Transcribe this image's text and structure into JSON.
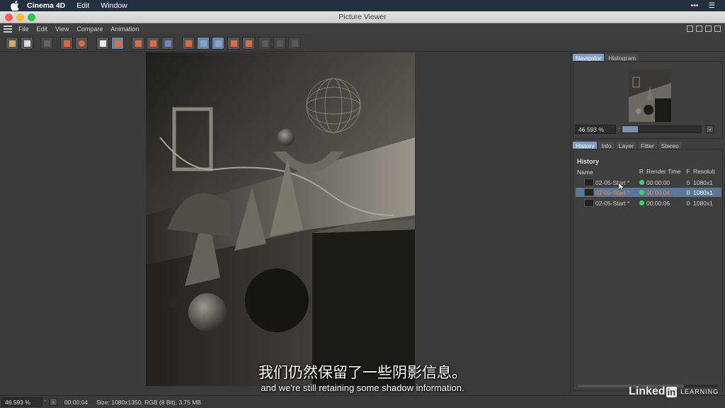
{
  "menubar": {
    "app_name": "Cinema 4D",
    "items": [
      "Edit",
      "Window"
    ]
  },
  "window": {
    "title": "Picture Viewer",
    "colors": {
      "close": "#fe5f57",
      "minimize": "#febc2e",
      "zoom": "#28c840"
    }
  },
  "app_menu": [
    "File",
    "Edit",
    "View",
    "Compare",
    "Animation"
  ],
  "navigator": {
    "tabs": [
      "Navigator",
      "Histogram"
    ],
    "zoom_value": "46.593 %"
  },
  "history_panel": {
    "tabs": [
      "History",
      "Info",
      "Layer",
      "Filter",
      "Stereo"
    ],
    "section_title": "History",
    "columns": [
      "Name",
      "R",
      "Render Time",
      "F",
      "Resoluti"
    ],
    "rows": [
      {
        "name": "02-05-Start *",
        "time": "00:00:00",
        "frame": "0",
        "resolution": "1080x1",
        "selected": false
      },
      {
        "name": "02-05-Start *",
        "time": "00:00:04",
        "frame": "0",
        "resolution": "1080x1",
        "selected": true
      },
      {
        "name": "02-05-Start *",
        "time": "00:00:06",
        "frame": "0",
        "resolution": "1080x1",
        "selected": false
      }
    ]
  },
  "status": {
    "zoom": "46.593 %",
    "time": "00:00:04",
    "info": "Size: 1080x1350, RGB (8 Bit), 3.75 MB"
  },
  "subtitles": {
    "cn": "我们仍然保留了一些阴影信息。",
    "en": "and we're still retaining some shadow information."
  },
  "watermark": {
    "linked": "Linked",
    "in": "in",
    "learning": "LEARNING"
  }
}
